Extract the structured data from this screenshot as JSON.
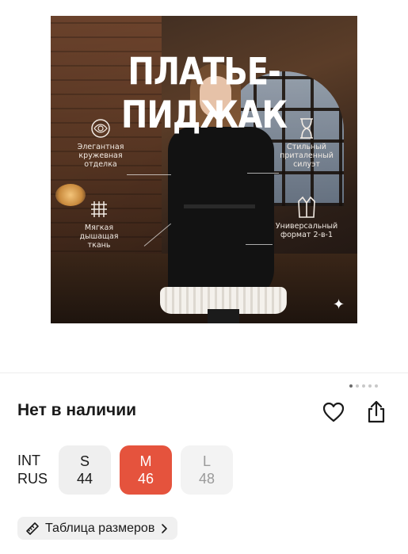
{
  "product_image": {
    "headline": "ПЛАТЬЕ-ПИДЖАК",
    "features": [
      {
        "icon": "lace-icon",
        "text": "Элегантная кружевная отделка"
      },
      {
        "icon": "hourglass-icon",
        "text": "Стильный приталенный силуэт"
      },
      {
        "icon": "fabric-grid-icon",
        "text": "Мягкая дышащая ткань"
      },
      {
        "icon": "blazer-icon",
        "text": "Универсальный формат 2-в-1"
      }
    ],
    "sparkle_icon": "sparkle-icon",
    "carousel_dots": 5,
    "active_dot": 0
  },
  "product": {
    "availability": "Нет в наличии",
    "favorite_icon": "heart-icon",
    "share_icon": "share-icon"
  },
  "sizes": {
    "systems": [
      "INT",
      "RUS"
    ],
    "options": [
      {
        "int": "S",
        "rus": "44",
        "selected": false,
        "available": true
      },
      {
        "int": "M",
        "rus": "46",
        "selected": true,
        "available": true
      },
      {
        "int": "L",
        "rus": "48",
        "selected": false,
        "available": false
      }
    ],
    "size_chart_label": "Таблица размеров",
    "size_chart_icon": "ruler-icon",
    "chevron_icon": "chevron-right-icon"
  },
  "colors": {
    "selected": "#e5533d",
    "chip": "#efefef"
  }
}
